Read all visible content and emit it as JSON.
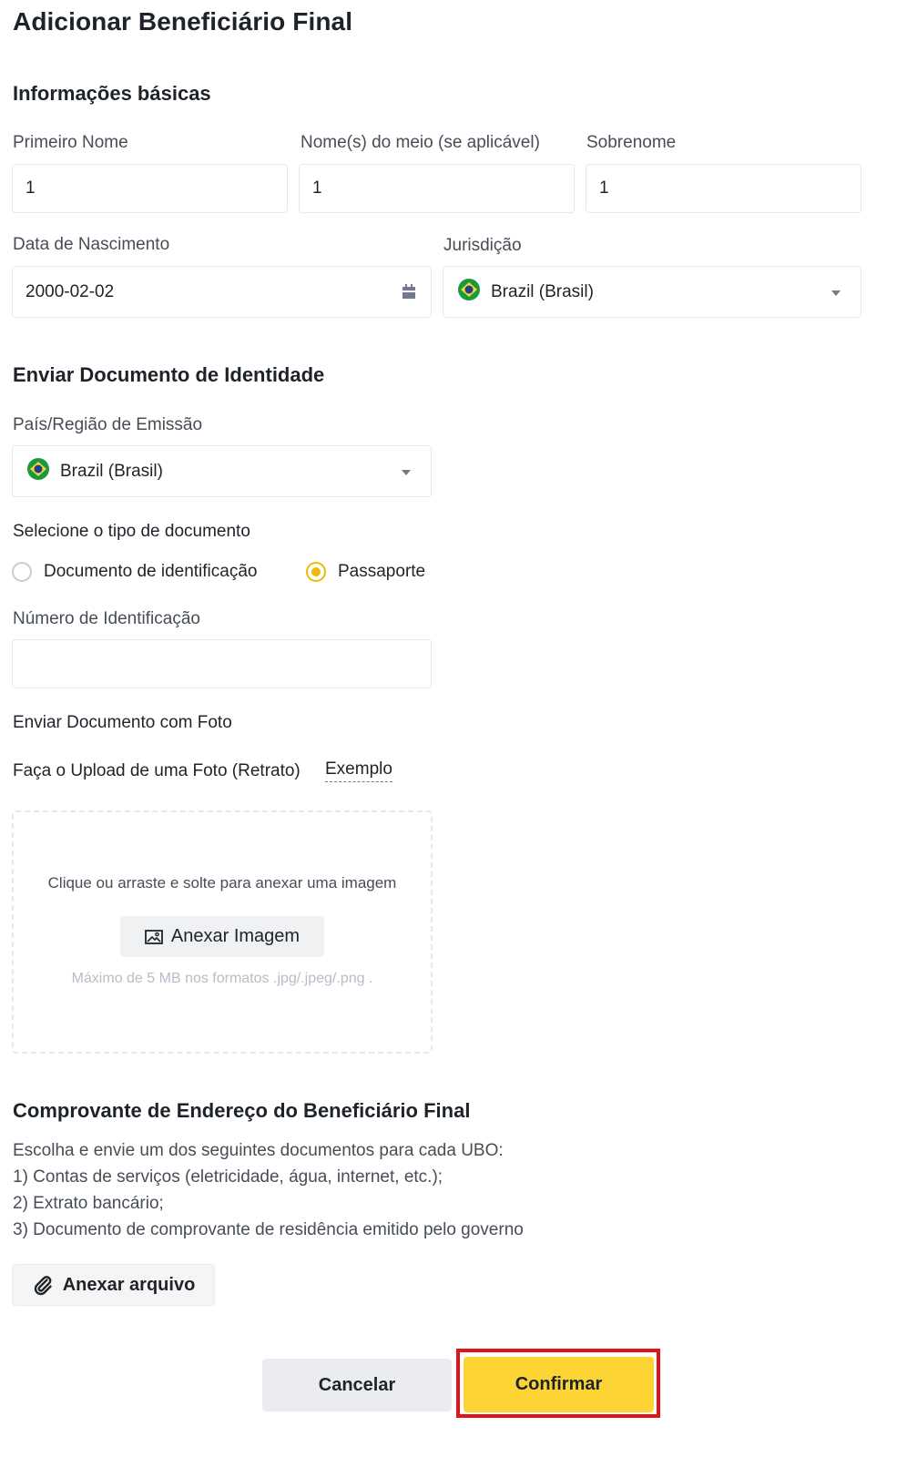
{
  "page": {
    "title": "Adicionar Beneficiário Final"
  },
  "basic": {
    "heading": "Informações básicas",
    "first_name_label": "Primeiro Nome",
    "first_name_value": "1",
    "middle_name_label": "Nome(s) do meio (se aplicável)",
    "middle_name_value": "1",
    "last_name_label": "Sobrenome",
    "last_name_value": "1",
    "dob_label": "Data de Nascimento",
    "dob_value": "2000-02-02",
    "jurisdiction_label": "Jurisdição",
    "jurisdiction_value": "Brazil (Brasil)"
  },
  "identity": {
    "heading": "Enviar Documento de Identidade",
    "country_label": "País/Região de Emissão",
    "country_value": "Brazil (Brasil)",
    "doc_type_label": "Selecione o tipo de documento",
    "doc_type_options": [
      "Documento de identificação",
      "Passaporte"
    ],
    "doc_type_selected": "Passaporte",
    "id_number_label": "Número de Identificação",
    "id_number_value": "",
    "photo_doc_label": "Enviar Documento com Foto",
    "upload_label": "Faça o Upload de uma Foto (Retrato)",
    "example_link": "Exemplo",
    "dropzone_hint": "Clique ou arraste e solte para anexar uma imagem",
    "attach_image_button": "Anexar Imagem",
    "size_hint": "Máximo de 5 MB nos formatos .jpg/.jpeg/.png ."
  },
  "address": {
    "heading": "Comprovante de Endereço do Beneficiário Final",
    "intro": "Escolha e envie um dos seguintes documentos para cada UBO:",
    "items": [
      "1) Contas de serviços (eletricidade, água, internet, etc.);",
      "2) Extrato bancário;",
      "3) Documento de comprovante de residência emitido pelo governo"
    ],
    "attach_file_button": "Anexar arquivo"
  },
  "actions": {
    "cancel": "Cancelar",
    "confirm": "Confirmar"
  },
  "colors": {
    "accent": "#fcd535",
    "radio_selected": "#f0b90b",
    "highlight_border": "#e0131a"
  },
  "icons": [
    "calendar-icon",
    "brazil-flag-icon",
    "chevron-down-icon",
    "image-icon",
    "paperclip-icon"
  ]
}
